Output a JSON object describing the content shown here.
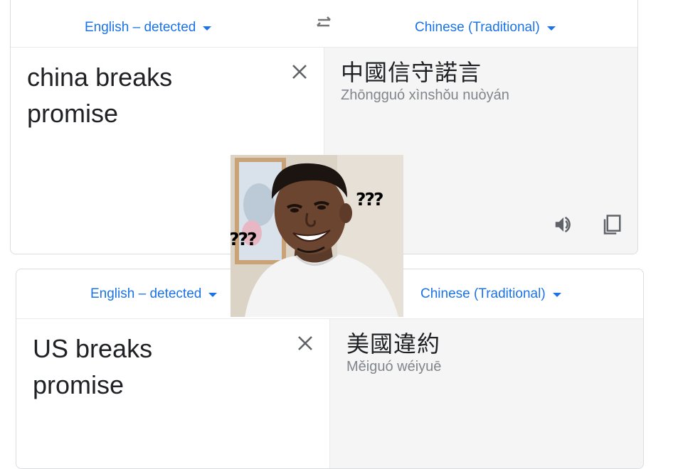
{
  "top": {
    "source_lang": "English – detected",
    "target_lang": "Chinese (Traditional)",
    "source_text_line1": "china breaks",
    "source_text_line2": "promise",
    "translation": "中國信守諾言",
    "romanization": "Zhōngguó xìnshǒu nuòyán"
  },
  "bottom": {
    "source_lang": "English – detected",
    "target_lang": "Chinese (Traditional)",
    "source_text_line1": "US breaks",
    "source_text_line2": "promise",
    "translation": "美國違約",
    "romanization": "Měiguó wéiyuē"
  },
  "meme": {
    "caption_right": "???",
    "caption_left": "???"
  },
  "icons": {
    "swap": "swap-arrows-icon",
    "clear": "close-icon",
    "speak": "speaker-icon",
    "copy": "copy-icon"
  },
  "colors": {
    "accent": "#1a73e8",
    "text": "#202124",
    "muted": "#80868b",
    "target_bg": "#f5f5f5",
    "border": "#dadce0"
  }
}
